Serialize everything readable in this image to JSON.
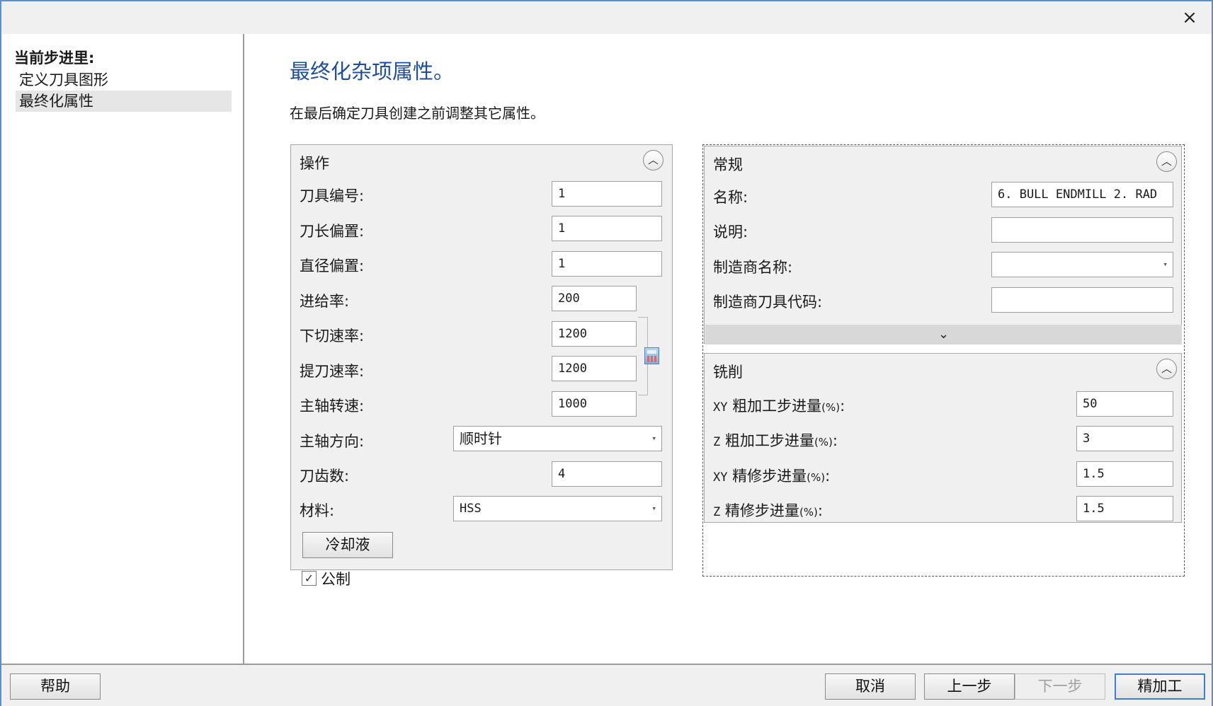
{
  "window": {
    "close_label": "×"
  },
  "sidebar": {
    "title": "当前步进里:",
    "items": [
      {
        "label": "定义刀具图形",
        "selected": false
      },
      {
        "label": "最终化属性",
        "selected": true
      }
    ]
  },
  "main": {
    "title": "最终化杂项属性。",
    "description": "在最后确定刀具创建之前调整其它属性。"
  },
  "operation": {
    "header": "操作",
    "tool_number": {
      "label": "刀具编号:",
      "value": "1"
    },
    "length_offset": {
      "label": "刀长偏置:",
      "value": "1"
    },
    "diameter_offset": {
      "label": "直径偏置:",
      "value": "1"
    },
    "feed_rate": {
      "label": "进给率:",
      "value": "200"
    },
    "plunge_rate": {
      "label": "下切速率:",
      "value": "1200"
    },
    "retract_rate": {
      "label": "提刀速率:",
      "value": "1200"
    },
    "spindle_speed": {
      "label": "主轴转速:",
      "value": "1000"
    },
    "spindle_direction": {
      "label": "主轴方向:",
      "value": "顺时针"
    },
    "flute_count": {
      "label": "刀齿数:",
      "value": "4"
    },
    "material": {
      "label": "材料:",
      "value": "HSS"
    },
    "coolant_button": "冷却液",
    "metric": {
      "label": "公制",
      "checked": true,
      "mark": "✓"
    }
  },
  "general": {
    "header": "常规",
    "name": {
      "label": "名称:",
      "value": "6. BULL ENDMILL 2. RAD"
    },
    "description": {
      "label": "说明:",
      "value": ""
    },
    "manufacturer_name": {
      "label": "制造商名称:",
      "value": ""
    },
    "manufacturer_code": {
      "label": "制造商刀具代码:",
      "value": ""
    },
    "expand_glyph": "⌄"
  },
  "milling": {
    "header": "铣削",
    "rows": [
      {
        "prefix": "XY",
        "label": " 粗加工步进量",
        "unit": "(%)",
        "suffix": ":",
        "value": "50"
      },
      {
        "prefix": "Z",
        "label": " 粗加工步进量",
        "unit": "(%)",
        "suffix": ":",
        "value": "3"
      },
      {
        "prefix": "XY",
        "label": " 精修步进量",
        "unit": "(%)",
        "suffix": ":",
        "value": "1.5"
      },
      {
        "prefix": "Z",
        "label": " 精修步进量",
        "unit": "(%)",
        "suffix": ":",
        "value": "1.5"
      }
    ]
  },
  "footer": {
    "help": "帮助",
    "cancel": "取消",
    "back": "上一步",
    "next": "下一步",
    "finish": "精加工"
  },
  "icons": {
    "collapse": "︿",
    "dropdown": "▾"
  }
}
